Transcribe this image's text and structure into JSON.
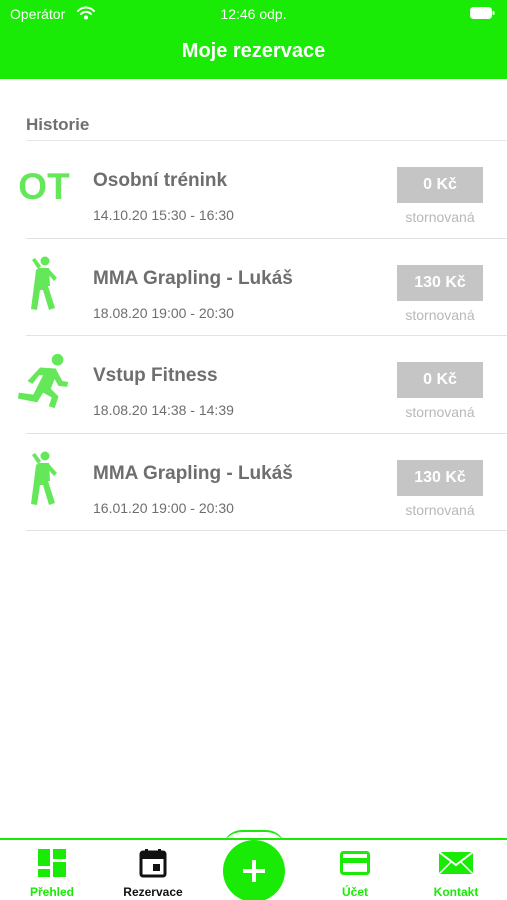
{
  "status_bar": {
    "carrier": "Operátor",
    "time": "12:46 odp."
  },
  "nav": {
    "title": "Moje rezervace"
  },
  "section": {
    "label": "Historie"
  },
  "reservations": [
    {
      "icon": "ot-text-icon",
      "icon_text": "OT",
      "title": "Osobní trénink",
      "time": "14.10.20 15:30 - 16:30",
      "price": "0 Kč",
      "status": "stornovaná"
    },
    {
      "icon": "stretching-person-icon",
      "title": "MMA Grapling - Lukáš",
      "time": "18.08.20 19:00 - 20:30",
      "price": "130 Kč",
      "status": "stornovaná"
    },
    {
      "icon": "running-person-icon",
      "title": "Vstup Fitness",
      "time": "18.08.20 14:38 - 14:39",
      "price": "0 Kč",
      "status": "stornovaná"
    },
    {
      "icon": "stretching-person-icon",
      "title": "MMA Grapling - Lukáš",
      "time": "16.01.20 19:00 - 20:30",
      "price": "130 Kč",
      "status": "stornovaná"
    }
  ],
  "tabbar": {
    "overview": "Přehled",
    "reservations": "Rezervace",
    "account": "Účet",
    "contact": "Kontakt"
  },
  "colors": {
    "accent": "#19eb06",
    "icon_green": "#64e85a",
    "badge": "#c5c5c5",
    "selected_tab": "#111111"
  }
}
